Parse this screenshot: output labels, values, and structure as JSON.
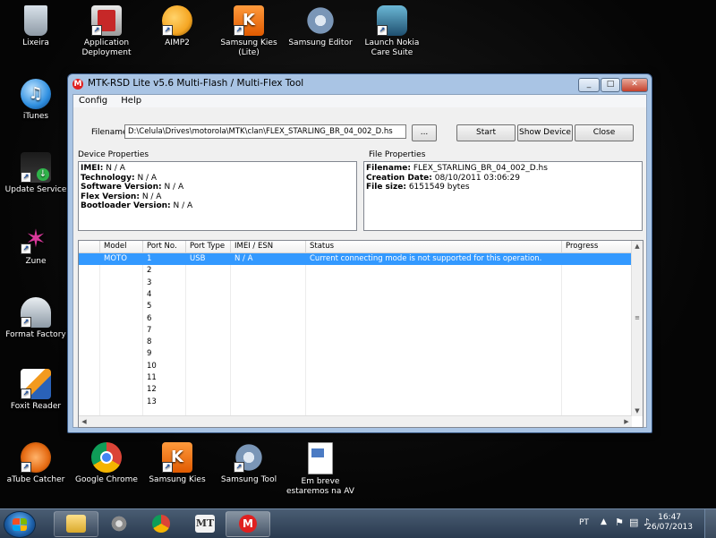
{
  "desktop": {
    "icons": [
      {
        "label": "Lixeira",
        "color": "#9aa7b3"
      },
      {
        "label": "Application Deployment",
        "color": "#c62828"
      },
      {
        "label": "AIMP2",
        "color": "#f5a623"
      },
      {
        "label": "Samsung Kies (Lite)",
        "color": "#f07a1a"
      },
      {
        "label": "Samsung Editor",
        "color": "#6e8fb5"
      },
      {
        "label": "Launch Nokia Care Suite",
        "color": "#3a6f8f"
      },
      {
        "label": "iTunes",
        "color": "#2f8fe0"
      },
      {
        "label": "Update Service",
        "color": "#1f6aa5"
      },
      {
        "label": "Zune",
        "color": "#d8399a"
      },
      {
        "label": "Format Factory",
        "color": "#8d9aa6"
      },
      {
        "label": "Foxit Reader",
        "color": "#2a62b8"
      },
      {
        "label": "aTube Catcher",
        "color": "#e56a12"
      },
      {
        "label": "Google Chrome",
        "color": "#2e9e44"
      },
      {
        "label": "Samsung Kies",
        "color": "#f07a1a"
      },
      {
        "label": "Samsung Tool",
        "color": "#7a96b7"
      },
      {
        "label": "Em breve estaremos na AV",
        "color": "#4b7bc4"
      }
    ]
  },
  "window": {
    "title": "MTK-RSD Lite v5.6 Multi-Flash / Multi-Flex Tool",
    "menu": [
      "Config",
      "Help"
    ],
    "filename_label": "Filename:",
    "filename_value": "D:\\Celula\\Drives\\motorola\\MTK\\clan\\FLEX_STARLING_BR_04_002_D.hs",
    "browse_label": "...",
    "start_label": "Start",
    "show_device_label": "Show Device",
    "close_label": "Close",
    "device_properties_title": "Device Properties",
    "device_properties": [
      {
        "key": "IMEI:",
        "value": "N / A"
      },
      {
        "key": "Technology:",
        "value": "N / A"
      },
      {
        "key": "Software Version:",
        "value": "N / A"
      },
      {
        "key": "Flex Version:",
        "value": "N / A"
      },
      {
        "key": "Bootloader Version:",
        "value": "N / A"
      }
    ],
    "file_properties_title": "File Properties",
    "file_properties": [
      {
        "key": "Filename:",
        "value": "FLEX_STARLING_BR_04_002_D.hs"
      },
      {
        "key": "Creation Date:",
        "value": "08/10/2011 03:06:29"
      },
      {
        "key": "File size:",
        "value": "6151549 bytes"
      }
    ],
    "table": {
      "columns": [
        "",
        "Model",
        "Port No.",
        "Port Type",
        "IMEI / ESN",
        "Status",
        "Progress"
      ],
      "rows": [
        {
          "model": "MOTO",
          "port": "1",
          "type": "USB",
          "imei": "N / A",
          "status": "Current connecting mode is not supported for this operation."
        },
        {
          "model": "",
          "port": "2",
          "type": "",
          "imei": "",
          "status": ""
        },
        {
          "model": "",
          "port": "3",
          "type": "",
          "imei": "",
          "status": ""
        },
        {
          "model": "",
          "port": "4",
          "type": "",
          "imei": "",
          "status": ""
        },
        {
          "model": "",
          "port": "5",
          "type": "",
          "imei": "",
          "status": ""
        },
        {
          "model": "",
          "port": "6",
          "type": "",
          "imei": "",
          "status": ""
        },
        {
          "model": "",
          "port": "7",
          "type": "",
          "imei": "",
          "status": ""
        },
        {
          "model": "",
          "port": "8",
          "type": "",
          "imei": "",
          "status": ""
        },
        {
          "model": "",
          "port": "9",
          "type": "",
          "imei": "",
          "status": ""
        },
        {
          "model": "",
          "port": "10",
          "type": "",
          "imei": "",
          "status": ""
        },
        {
          "model": "",
          "port": "11",
          "type": "",
          "imei": "",
          "status": ""
        },
        {
          "model": "",
          "port": "12",
          "type": "",
          "imei": "",
          "status": ""
        },
        {
          "model": "",
          "port": "13",
          "type": "",
          "imei": "",
          "status": ""
        }
      ]
    }
  },
  "taskbar": {
    "language": "PT",
    "time": "16:47",
    "date": "26/07/2013",
    "mt_label": "MT"
  }
}
